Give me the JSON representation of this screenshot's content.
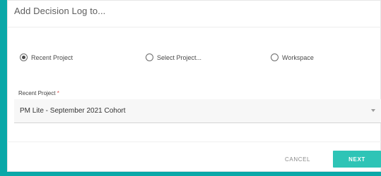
{
  "dialog": {
    "title": "Add Decision Log to...",
    "radio_options": [
      {
        "label": "Recent Project",
        "selected": true
      },
      {
        "label": "Select Project...",
        "selected": false
      },
      {
        "label": "Workspace",
        "selected": false
      }
    ],
    "field": {
      "label": "Recent Project",
      "required_marker": "*",
      "value": "PM Lite - September 2021 Cohort"
    },
    "buttons": {
      "cancel": "CANCEL",
      "next": "NEXT"
    }
  },
  "colors": {
    "background_teal": "#0aa8a8",
    "accent_button": "#2ec4b6",
    "required": "#d9534f"
  }
}
